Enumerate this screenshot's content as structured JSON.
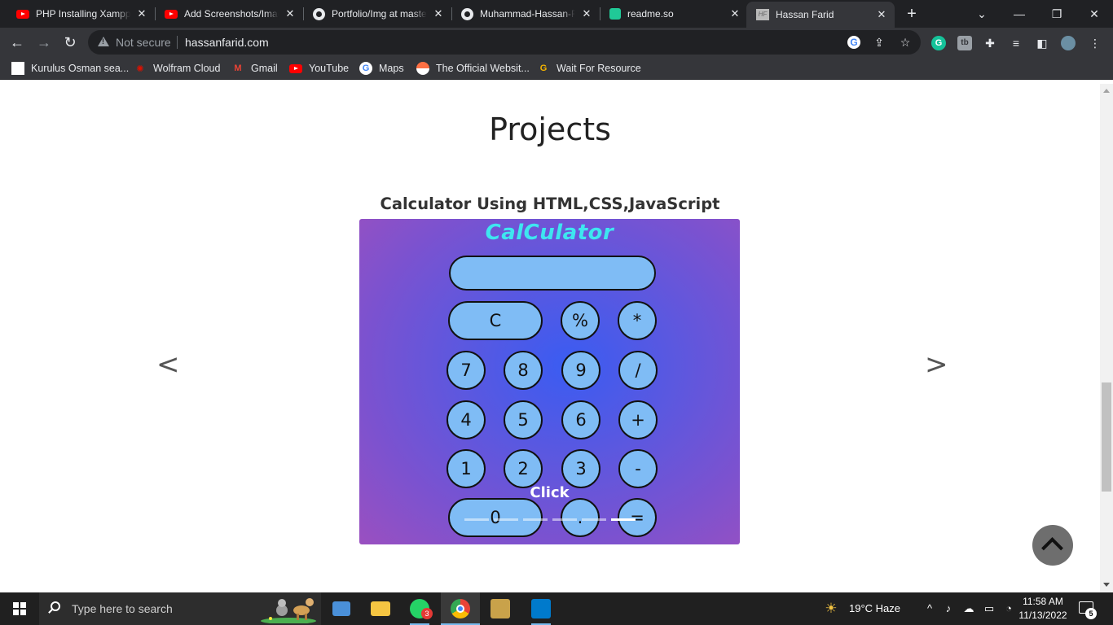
{
  "tabs": [
    {
      "title": "PHP Installing Xampp",
      "favicon": "youtube-icon"
    },
    {
      "title": "Add Screenshots/Images",
      "favicon": "youtube-icon"
    },
    {
      "title": "Portfolio/Img at master",
      "favicon": "github-icon"
    },
    {
      "title": "Muhammad-Hassan-Farid",
      "favicon": "github-icon"
    },
    {
      "title": "readme.so",
      "favicon": "readme-icon"
    },
    {
      "title": "Hassan Farid",
      "favicon": "site-icon"
    }
  ],
  "tab_close_glyph": "✕",
  "new_tab_glyph": "+",
  "window_controls": {
    "minimize": "—",
    "restore": "❐",
    "close": "✕",
    "tab_search": "⌄"
  },
  "toolbar": {
    "security_label": "Not secure",
    "url": "hassanfarid.com"
  },
  "bookmarks": [
    {
      "label": "Kurulus Osman sea...",
      "icon": "page-icon"
    },
    {
      "label": "Wolfram Cloud",
      "icon": "wolfram-icon"
    },
    {
      "label": "Gmail",
      "icon": "gmail-icon"
    },
    {
      "label": "YouTube",
      "icon": "youtube-icon"
    },
    {
      "label": "Maps",
      "icon": "google-icon"
    },
    {
      "label": "The Official Websit...",
      "icon": "site-icon"
    },
    {
      "label": "Wait For Resource",
      "icon": "g-icon"
    }
  ],
  "page": {
    "heading": "Projects",
    "project_title": "Calculator Using HTML,CSS,JavaScript",
    "prev_arrow": "<",
    "next_arrow": ">",
    "calculator": {
      "heading": "CalCulator",
      "display_value": "",
      "buttons": [
        "C",
        "%",
        "*",
        "7",
        "8",
        "9",
        "/",
        "4",
        "5",
        "6",
        "+",
        "1",
        "2",
        "3",
        "-",
        "0",
        ".",
        "="
      ]
    },
    "click_label": "Click",
    "carousel": {
      "slide_count": 6,
      "active_index": 5
    }
  },
  "taskbar": {
    "search_placeholder": "Type here to search",
    "whatsapp_badge": "3",
    "weather": "19°C  Haze",
    "time": "11:58 AM",
    "date": "11/13/2022",
    "notifications": "5"
  },
  "colors": {
    "chrome_dark": "#202124",
    "toolbar": "#35363a",
    "calc_display": "#7fbcf5",
    "calc_heading": "#3ee6f0",
    "calc_gradient_center": "#3a5cf2",
    "calc_gradient_edge": "#9a50c0"
  }
}
